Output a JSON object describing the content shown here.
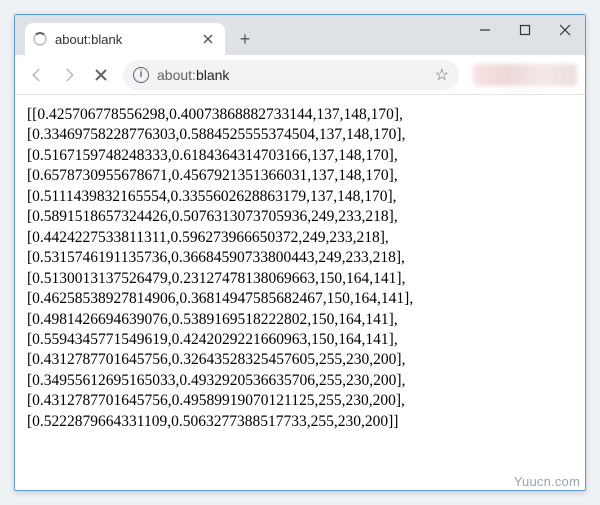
{
  "window": {
    "tab_title": "about:blank",
    "url_prefix": "about:",
    "url_path": "blank"
  },
  "content_lines": [
    "[[0.425706778556298,0.40073868882733144,137,148,170],",
    "[0.33469758228776303,0.5884525555374504,137,148,170],",
    "[0.5167159748248333,0.6184364314703166,137,148,170],",
    "[0.6578730955678671,0.4567921351366031,137,148,170],",
    "[0.5111439832165554,0.3355602628863179,137,148,170],",
    "[0.5891518657324426,0.5076313073705936,249,233,218],",
    "[0.4424227533811311,0.596273966650372,249,233,218],",
    "[0.5315746191135736,0.36684590733800443,249,233,218],",
    "[0.5130013137526479,0.23127478138069663,150,164,141],",
    "[0.46258538927814906,0.36814947585682467,150,164,141],",
    "[0.4981426694639076,0.5389169518222802,150,164,141],",
    "[0.5594345771549619,0.4242029221660963,150,164,141],",
    "[0.4312787701645756,0.32643528325457605,255,230,200],",
    "[0.34955612695165033,0.4932920536635706,255,230,200],",
    "[0.4312787701645756,0.49589919070121125,255,230,200],",
    "[0.5222879664331109,0.5063277388517733,255,230,200]]"
  ],
  "watermark": "Yuucn.com"
}
